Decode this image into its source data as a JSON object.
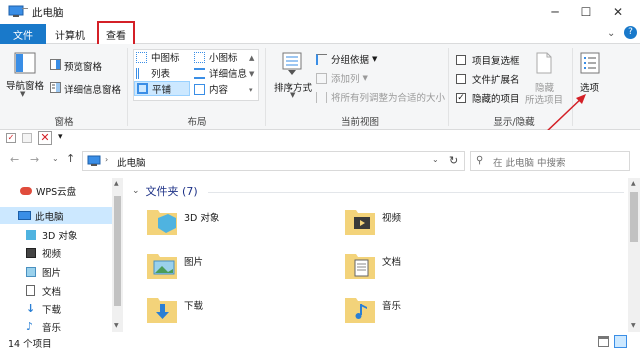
{
  "window": {
    "title": "此电脑",
    "minimize": "─",
    "maximize": "☐",
    "close": "✕"
  },
  "tabs": {
    "file": "文件",
    "computer": "计算机",
    "view": "查看"
  },
  "ribbon": {
    "panes": {
      "nav_pane": "导航窗格",
      "preview_pane": "预览窗格",
      "details_pane": "详细信息窗格",
      "group_label": "窗格"
    },
    "layout": {
      "items": [
        "中图标",
        "小图标",
        "列表",
        "详细信息",
        "平铺",
        "内容"
      ],
      "selected": "平铺",
      "group_label": "布局"
    },
    "current_view": {
      "sort_by": "排序方式",
      "group_by": "分组依据",
      "add_column": "添加列",
      "fit_columns": "将所有列调整为合适的大小",
      "group_label": "当前视图"
    },
    "show_hide": {
      "item_checkboxes": "项目复选框",
      "file_extensions": "文件扩展名",
      "hidden_items": "隐藏的项目",
      "hide_selected_1": "隐藏",
      "hide_selected_2": "所选项目",
      "group_label": "显示/隐藏",
      "checks": {
        "item_checkboxes": false,
        "file_extensions": false,
        "hidden_items": true
      }
    },
    "options": "选项"
  },
  "address": {
    "location": "此电脑",
    "search_placeholder": "在 此电脑 中搜索"
  },
  "sidebar": {
    "items": [
      "WPS云盘",
      "此电脑",
      "3D 对象",
      "视频",
      "图片",
      "文档",
      "下载",
      "音乐"
    ]
  },
  "content": {
    "group_header": "文件夹 (7)",
    "folders": [
      "3D 对象",
      "视频",
      "图片",
      "文档",
      "下载",
      "音乐"
    ]
  },
  "status": {
    "count": "14 个项目"
  },
  "colors": {
    "accent": "#1979ca",
    "highlight": "#d42027",
    "selection": "#cce8ff"
  }
}
